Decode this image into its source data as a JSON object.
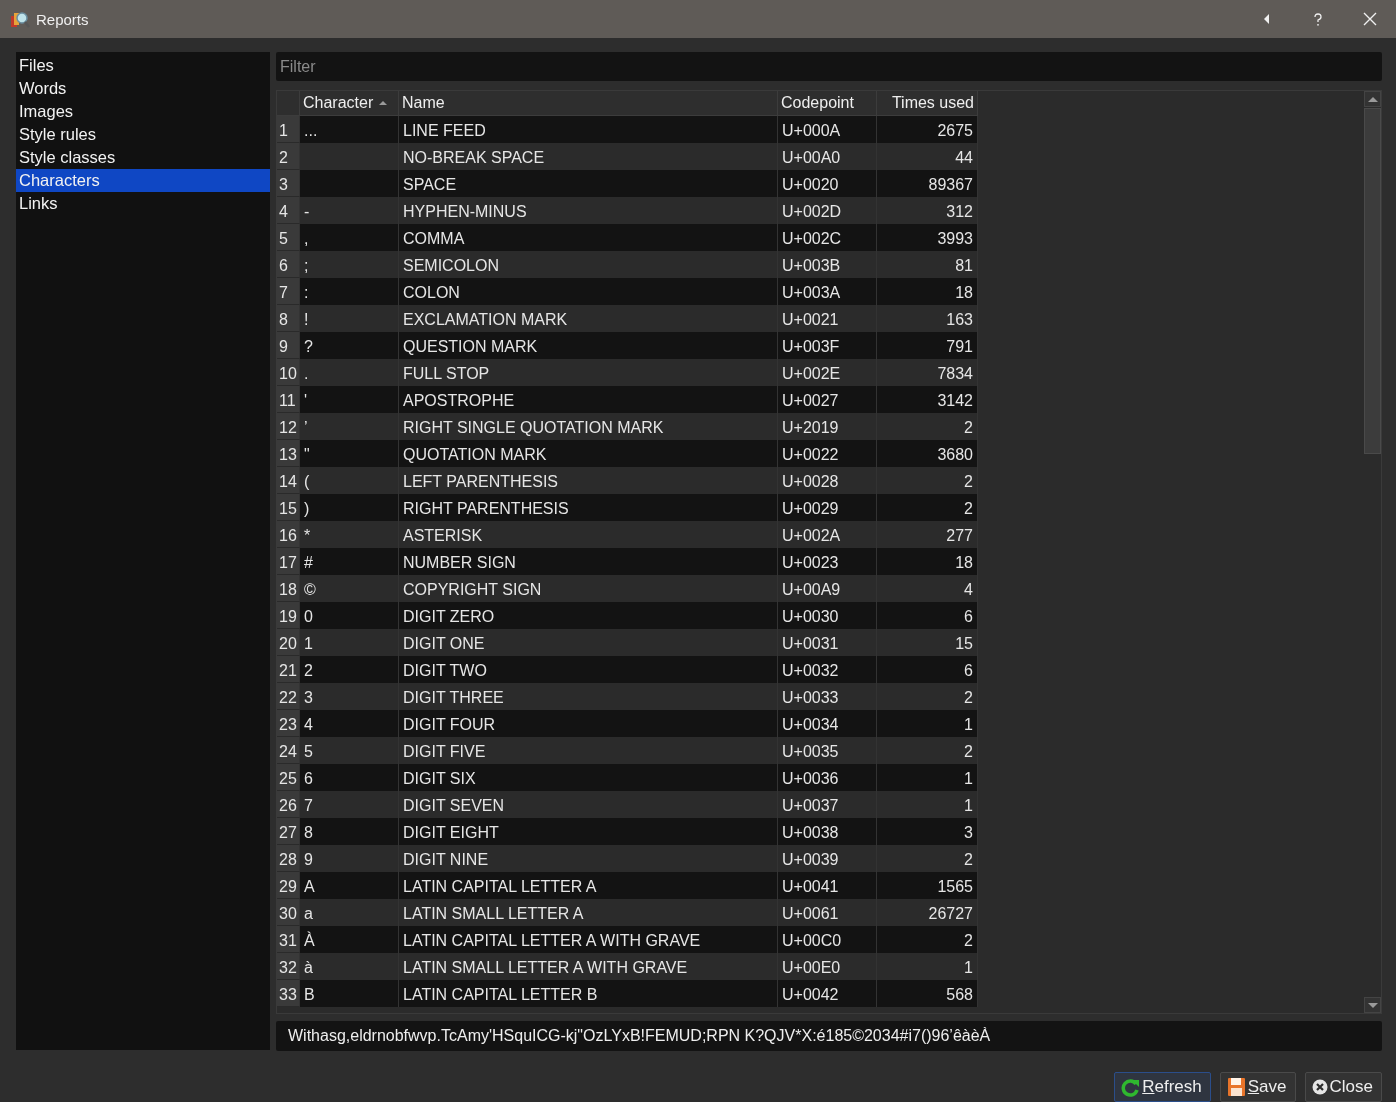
{
  "window": {
    "title": "Reports"
  },
  "sidebar": {
    "items": [
      {
        "label": "Files",
        "selected": false
      },
      {
        "label": "Words",
        "selected": false
      },
      {
        "label": "Images",
        "selected": false
      },
      {
        "label": "Style rules",
        "selected": false
      },
      {
        "label": "Style classes",
        "selected": false
      },
      {
        "label": "Characters",
        "selected": true
      },
      {
        "label": "Links",
        "selected": false
      }
    ]
  },
  "filter": {
    "placeholder": "Filter"
  },
  "table": {
    "columns": [
      {
        "label": "Character",
        "sorted": true
      },
      {
        "label": "Name",
        "sorted": false
      },
      {
        "label": "Codepoint",
        "sorted": false
      },
      {
        "label": "Times used",
        "sorted": false
      }
    ],
    "rows": [
      {
        "number": "1",
        "character": "...",
        "name": "LINE FEED",
        "codepoint": "U+000A",
        "times_used": "2675"
      },
      {
        "number": "2",
        "name": "NO-BREAK SPACE",
        "codepoint": "U+00A0",
        "times_used": "44"
      },
      {
        "number": "3",
        "name": "SPACE",
        "codepoint": "U+0020",
        "times_used": "89367"
      },
      {
        "number": "4",
        "character": "-",
        "name": "HYPHEN-MINUS",
        "codepoint": "U+002D",
        "times_used": "312"
      },
      {
        "number": "5",
        "character": ",",
        "name": "COMMA",
        "codepoint": "U+002C",
        "times_used": "3993"
      },
      {
        "number": "6",
        "character": ";",
        "name": "SEMICOLON",
        "codepoint": "U+003B",
        "times_used": "81"
      },
      {
        "number": "7",
        "character": ":",
        "name": "COLON",
        "codepoint": "U+003A",
        "times_used": "18"
      },
      {
        "number": "8",
        "character": "!",
        "name": "EXCLAMATION MARK",
        "codepoint": "U+0021",
        "times_used": "163"
      },
      {
        "number": "9",
        "character": "?",
        "name": "QUESTION MARK",
        "codepoint": "U+003F",
        "times_used": "791"
      },
      {
        "number": "10",
        "character": ".",
        "name": "FULL STOP",
        "codepoint": "U+002E",
        "times_used": "7834"
      },
      {
        "number": "11",
        "character": "'",
        "name": "APOSTROPHE",
        "codepoint": "U+0027",
        "times_used": "3142"
      },
      {
        "number": "12",
        "character": "’",
        "name": "RIGHT SINGLE QUOTATION MARK",
        "codepoint": "U+2019",
        "times_used": "2"
      },
      {
        "number": "13",
        "character": "\"",
        "name": "QUOTATION MARK",
        "codepoint": "U+0022",
        "times_used": "3680"
      },
      {
        "number": "14",
        "character": "(",
        "name": "LEFT PARENTHESIS",
        "codepoint": "U+0028",
        "times_used": "2"
      },
      {
        "number": "15",
        "character": ")",
        "name": "RIGHT PARENTHESIS",
        "codepoint": "U+0029",
        "times_used": "2"
      },
      {
        "number": "16",
        "character": "*",
        "name": "ASTERISK",
        "codepoint": "U+002A",
        "times_used": "277"
      },
      {
        "number": "17",
        "character": "#",
        "name": "NUMBER SIGN",
        "codepoint": "U+0023",
        "times_used": "18"
      },
      {
        "number": "18",
        "character": "©",
        "name": "COPYRIGHT SIGN",
        "codepoint": "U+00A9",
        "times_used": "4"
      },
      {
        "number": "19",
        "character": "0",
        "name": "DIGIT ZERO",
        "codepoint": "U+0030",
        "times_used": "6"
      },
      {
        "number": "20",
        "character": "1",
        "name": "DIGIT ONE",
        "codepoint": "U+0031",
        "times_used": "15"
      },
      {
        "number": "21",
        "character": "2",
        "name": "DIGIT TWO",
        "codepoint": "U+0032",
        "times_used": "6"
      },
      {
        "number": "22",
        "character": "3",
        "name": "DIGIT THREE",
        "codepoint": "U+0033",
        "times_used": "2"
      },
      {
        "number": "23",
        "character": "4",
        "name": "DIGIT FOUR",
        "codepoint": "U+0034",
        "times_used": "1"
      },
      {
        "number": "24",
        "character": "5",
        "name": "DIGIT FIVE",
        "codepoint": "U+0035",
        "times_used": "2"
      },
      {
        "number": "25",
        "character": "6",
        "name": "DIGIT SIX",
        "codepoint": "U+0036",
        "times_used": "1"
      },
      {
        "number": "26",
        "character": "7",
        "name": "DIGIT SEVEN",
        "codepoint": "U+0037",
        "times_used": "1"
      },
      {
        "number": "27",
        "character": "8",
        "name": "DIGIT EIGHT",
        "codepoint": "U+0038",
        "times_used": "3"
      },
      {
        "number": "28",
        "character": "9",
        "name": "DIGIT NINE",
        "codepoint": "U+0039",
        "times_used": "2"
      },
      {
        "number": "29",
        "character": "A",
        "name": "LATIN CAPITAL LETTER A",
        "codepoint": "U+0041",
        "times_used": "1565"
      },
      {
        "number": "30",
        "character": "a",
        "name": "LATIN SMALL LETTER A",
        "codepoint": "U+0061",
        "times_used": "26727"
      },
      {
        "number": "31",
        "character": "À",
        "name": "LATIN CAPITAL LETTER A WITH GRAVE",
        "codepoint": "U+00C0",
        "times_used": "2"
      },
      {
        "number": "32",
        "character": "à",
        "name": "LATIN SMALL LETTER A WITH GRAVE",
        "codepoint": "U+00E0",
        "times_used": "1"
      },
      {
        "number": "33",
        "character": "B",
        "name": "LATIN CAPITAL LETTER B",
        "codepoint": "U+0042",
        "times_used": "568"
      }
    ]
  },
  "sample_text": {
    "value": "Withasg,eldrnobfwvp.TcAmy'HSquICG-kj\"OzLYxB!FEMUD;RPN K?QJV*X:é185©2034#i7()96’êàèÀ"
  },
  "buttons": [
    {
      "label": "Refresh",
      "kind": "refresh",
      "first_letter_underlined": true,
      "default": true
    },
    {
      "label": "Save",
      "kind": "save",
      "first_letter_underlined": true,
      "default": false
    },
    {
      "label": "Close",
      "kind": "close",
      "first_letter_underlined": false,
      "default": false
    }
  ]
}
